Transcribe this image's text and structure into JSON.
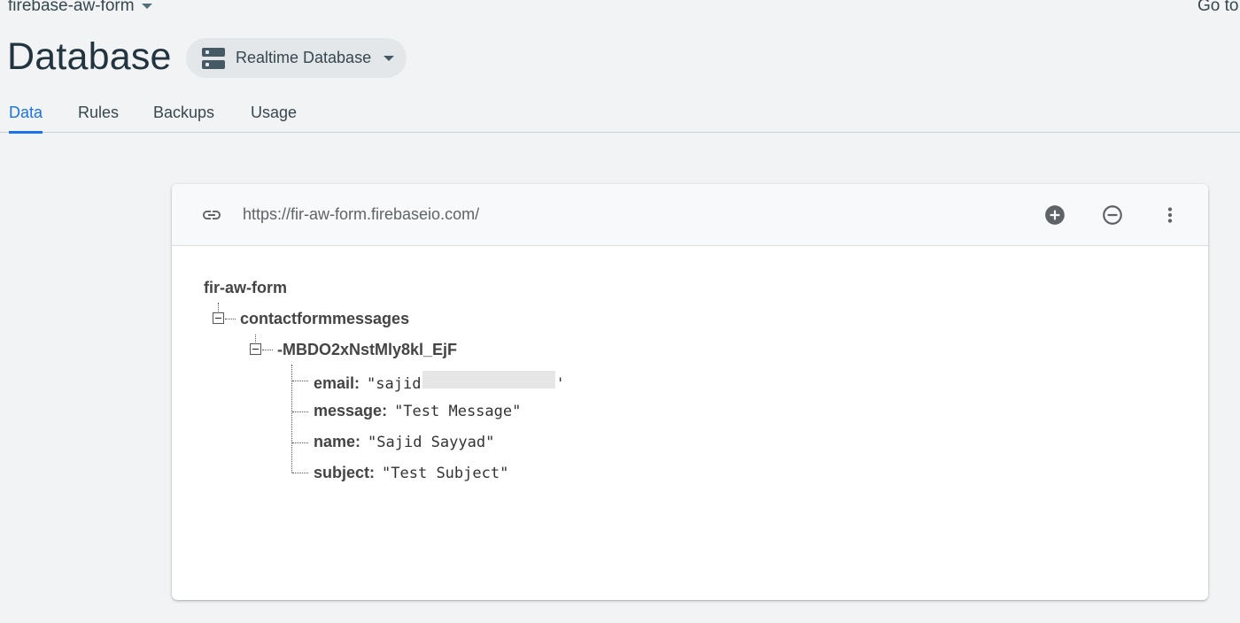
{
  "header": {
    "project_name": "firebase-aw-form",
    "goto_link": "Go to docs",
    "page_title": "Database",
    "db_selector_label": "Realtime Database"
  },
  "tabs": [
    {
      "label": "Data",
      "active": true
    },
    {
      "label": "Rules",
      "active": false
    },
    {
      "label": "Backups",
      "active": false
    },
    {
      "label": "Usage",
      "active": false
    }
  ],
  "card": {
    "url": "https://fir-aw-form.firebaseio.com/",
    "icons": [
      "link-icon",
      "add-circle-icon",
      "remove-circle-icon",
      "more-vert-icon"
    ]
  },
  "tree": {
    "root": "fir-aw-form",
    "child": "contactformmessages",
    "record": "-MBDO2xNstMly8kl_EjF",
    "fields": [
      {
        "key": "email",
        "value": "\"sajid",
        "redacted": true
      },
      {
        "key": "message",
        "value": "\"Test Message\""
      },
      {
        "key": "name",
        "value": "\"Sajid Sayyad\""
      },
      {
        "key": "subject",
        "value": "\"Test Subject\""
      }
    ]
  },
  "colors": {
    "accent": "#1a73e8",
    "background": "#f1f3f4",
    "title": "#22343f"
  }
}
